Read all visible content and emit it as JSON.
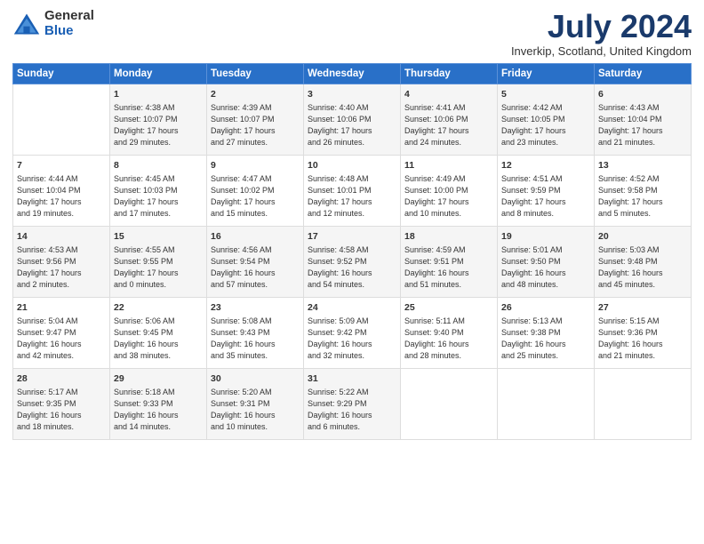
{
  "logo": {
    "general": "General",
    "blue": "Blue"
  },
  "header": {
    "month": "July 2024",
    "location": "Inverkip, Scotland, United Kingdom"
  },
  "days_of_week": [
    "Sunday",
    "Monday",
    "Tuesday",
    "Wednesday",
    "Thursday",
    "Friday",
    "Saturday"
  ],
  "weeks": [
    [
      {
        "day": "",
        "content": ""
      },
      {
        "day": "1",
        "content": "Sunrise: 4:38 AM\nSunset: 10:07 PM\nDaylight: 17 hours\nand 29 minutes."
      },
      {
        "day": "2",
        "content": "Sunrise: 4:39 AM\nSunset: 10:07 PM\nDaylight: 17 hours\nand 27 minutes."
      },
      {
        "day": "3",
        "content": "Sunrise: 4:40 AM\nSunset: 10:06 PM\nDaylight: 17 hours\nand 26 minutes."
      },
      {
        "day": "4",
        "content": "Sunrise: 4:41 AM\nSunset: 10:06 PM\nDaylight: 17 hours\nand 24 minutes."
      },
      {
        "day": "5",
        "content": "Sunrise: 4:42 AM\nSunset: 10:05 PM\nDaylight: 17 hours\nand 23 minutes."
      },
      {
        "day": "6",
        "content": "Sunrise: 4:43 AM\nSunset: 10:04 PM\nDaylight: 17 hours\nand 21 minutes."
      }
    ],
    [
      {
        "day": "7",
        "content": "Sunrise: 4:44 AM\nSunset: 10:04 PM\nDaylight: 17 hours\nand 19 minutes."
      },
      {
        "day": "8",
        "content": "Sunrise: 4:45 AM\nSunset: 10:03 PM\nDaylight: 17 hours\nand 17 minutes."
      },
      {
        "day": "9",
        "content": "Sunrise: 4:47 AM\nSunset: 10:02 PM\nDaylight: 17 hours\nand 15 minutes."
      },
      {
        "day": "10",
        "content": "Sunrise: 4:48 AM\nSunset: 10:01 PM\nDaylight: 17 hours\nand 12 minutes."
      },
      {
        "day": "11",
        "content": "Sunrise: 4:49 AM\nSunset: 10:00 PM\nDaylight: 17 hours\nand 10 minutes."
      },
      {
        "day": "12",
        "content": "Sunrise: 4:51 AM\nSunset: 9:59 PM\nDaylight: 17 hours\nand 8 minutes."
      },
      {
        "day": "13",
        "content": "Sunrise: 4:52 AM\nSunset: 9:58 PM\nDaylight: 17 hours\nand 5 minutes."
      }
    ],
    [
      {
        "day": "14",
        "content": "Sunrise: 4:53 AM\nSunset: 9:56 PM\nDaylight: 17 hours\nand 2 minutes."
      },
      {
        "day": "15",
        "content": "Sunrise: 4:55 AM\nSunset: 9:55 PM\nDaylight: 17 hours\nand 0 minutes."
      },
      {
        "day": "16",
        "content": "Sunrise: 4:56 AM\nSunset: 9:54 PM\nDaylight: 16 hours\nand 57 minutes."
      },
      {
        "day": "17",
        "content": "Sunrise: 4:58 AM\nSunset: 9:52 PM\nDaylight: 16 hours\nand 54 minutes."
      },
      {
        "day": "18",
        "content": "Sunrise: 4:59 AM\nSunset: 9:51 PM\nDaylight: 16 hours\nand 51 minutes."
      },
      {
        "day": "19",
        "content": "Sunrise: 5:01 AM\nSunset: 9:50 PM\nDaylight: 16 hours\nand 48 minutes."
      },
      {
        "day": "20",
        "content": "Sunrise: 5:03 AM\nSunset: 9:48 PM\nDaylight: 16 hours\nand 45 minutes."
      }
    ],
    [
      {
        "day": "21",
        "content": "Sunrise: 5:04 AM\nSunset: 9:47 PM\nDaylight: 16 hours\nand 42 minutes."
      },
      {
        "day": "22",
        "content": "Sunrise: 5:06 AM\nSunset: 9:45 PM\nDaylight: 16 hours\nand 38 minutes."
      },
      {
        "day": "23",
        "content": "Sunrise: 5:08 AM\nSunset: 9:43 PM\nDaylight: 16 hours\nand 35 minutes."
      },
      {
        "day": "24",
        "content": "Sunrise: 5:09 AM\nSunset: 9:42 PM\nDaylight: 16 hours\nand 32 minutes."
      },
      {
        "day": "25",
        "content": "Sunrise: 5:11 AM\nSunset: 9:40 PM\nDaylight: 16 hours\nand 28 minutes."
      },
      {
        "day": "26",
        "content": "Sunrise: 5:13 AM\nSunset: 9:38 PM\nDaylight: 16 hours\nand 25 minutes."
      },
      {
        "day": "27",
        "content": "Sunrise: 5:15 AM\nSunset: 9:36 PM\nDaylight: 16 hours\nand 21 minutes."
      }
    ],
    [
      {
        "day": "28",
        "content": "Sunrise: 5:17 AM\nSunset: 9:35 PM\nDaylight: 16 hours\nand 18 minutes."
      },
      {
        "day": "29",
        "content": "Sunrise: 5:18 AM\nSunset: 9:33 PM\nDaylight: 16 hours\nand 14 minutes."
      },
      {
        "day": "30",
        "content": "Sunrise: 5:20 AM\nSunset: 9:31 PM\nDaylight: 16 hours\nand 10 minutes."
      },
      {
        "day": "31",
        "content": "Sunrise: 5:22 AM\nSunset: 9:29 PM\nDaylight: 16 hours\nand 6 minutes."
      },
      {
        "day": "",
        "content": ""
      },
      {
        "day": "",
        "content": ""
      },
      {
        "day": "",
        "content": ""
      }
    ]
  ]
}
